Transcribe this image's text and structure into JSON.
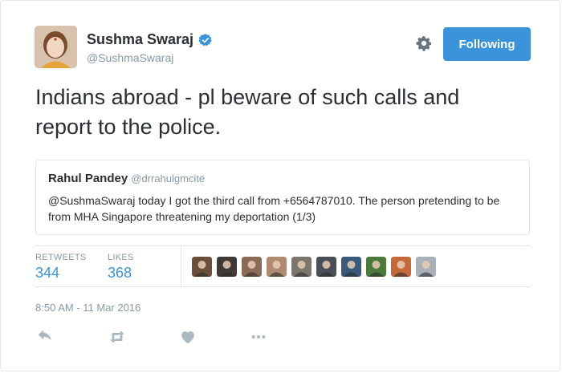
{
  "tweet": {
    "author": {
      "name": "Sushma Swaraj",
      "handle": "@SushmaSwaraj",
      "verified_icon": "verified-badge-icon",
      "avatar_colors": [
        "#d9c2ad",
        "#7a4b2c",
        "#f2d7c2"
      ]
    },
    "follow_button_label": "Following",
    "text": "Indians abroad - pl beware of such calls and report to the police.",
    "quoted": {
      "name": "Rahul Pandey",
      "handle": "@drrahulgmcite",
      "text": "@SushmaSwaraj today I got the third call from +6564787010. The person pretending to be from MHA Singapore threatening my deportation (1/3)"
    },
    "stats": {
      "retweets_label": "RETWEETS",
      "retweets_value": "344",
      "likes_label": "LIKES",
      "likes_value": "368"
    },
    "liker_avatar_colors": [
      "#6b4f3a",
      "#3f3a36",
      "#8a6b55",
      "#b08a70",
      "#7d766e",
      "#4a4e58",
      "#3a5a7a",
      "#4b7a3c",
      "#c46a3a",
      "#a9b0b8"
    ],
    "timestamp": "8:50 AM - 11 Mar 2016"
  },
  "colors": {
    "accent": "#3b94d9",
    "muted": "#8899a6",
    "text": "#292f33",
    "border": "#e1e8ed"
  }
}
